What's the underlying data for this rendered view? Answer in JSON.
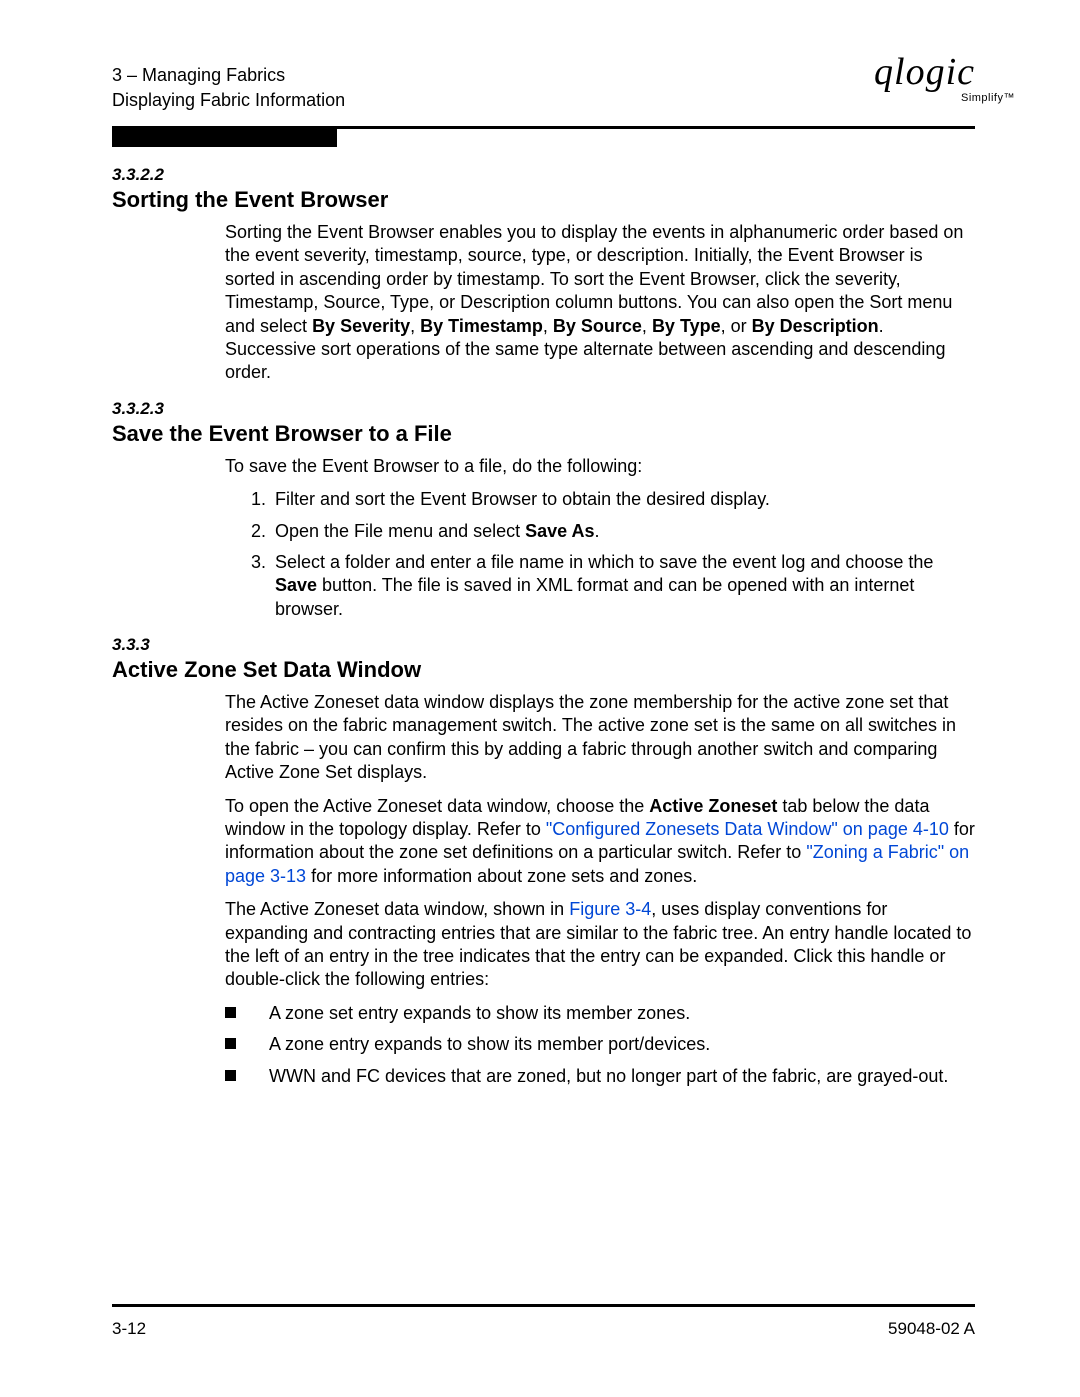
{
  "header": {
    "chapter_line": "3 – Managing Fabrics",
    "subtitle": "Displaying Fabric Information",
    "logo_main": "qlogic",
    "logo_sub": "Simplify™"
  },
  "section1": {
    "num": "3.3.2.2",
    "title": "Sorting the Event Browser",
    "para_a": "Sorting the Event Browser enables you to display the events in alphanumeric order based on the event severity, timestamp, source, type, or description. Initially, the Event Browser is sorted in ascending order by timestamp. To sort the Event Browser, click the severity, Timestamp, Source, Type, or Description column buttons. You can also open the Sort menu and select ",
    "bold1": "By Severity",
    "sep1": ", ",
    "bold2": "By Timestamp",
    "sep2": ", ",
    "bold3": "By Source",
    "sep3": ", ",
    "bold4": "By Type",
    "sep4": ", or ",
    "bold5": "By Description",
    "tail": ". Successive sort operations of the same type alternate between ascending and descending order."
  },
  "section2": {
    "num": "3.3.2.3",
    "title": "Save the Event Browser to a File",
    "intro": "To save the Event Browser to a file, do the following:",
    "step1": "Filter and sort the Event Browser to obtain the desired display.",
    "step2_a": "Open the File menu and select ",
    "step2_b": "Save As",
    "step2_c": ".",
    "step3_a": "Select a folder and enter a file name in which to save the event log and choose the ",
    "step3_b": "Save",
    "step3_c": " button. The file is saved in XML format and can be opened with an internet browser."
  },
  "section3": {
    "num": "3.3.3",
    "title": "Active Zone Set Data Window",
    "p1": "The Active Zoneset data window displays the zone membership for the active zone set that resides on the fabric management switch. The active zone set is the same on all switches in the fabric – you can confirm this by adding a fabric through another switch and comparing Active Zone Set displays.",
    "p2_a": "To open the Active Zoneset data window, choose the ",
    "p2_b": "Active Zoneset",
    "p2_c": " tab below the data window in the topology display. Refer to ",
    "p2_link1": "\"Configured Zonesets Data Window\" on page 4-10",
    "p2_d": " for information about the zone set definitions on a particular switch. Refer to ",
    "p2_link2": "\"Zoning a Fabric\" on page 3-13",
    "p2_e": " for more information about zone sets and zones.",
    "p3_a": "The Active Zoneset data window, shown in ",
    "p3_link": "Figure 3-4",
    "p3_b": ", uses display conventions for expanding and contracting entries that are similar to the fabric tree. An entry handle located to the left of an entry in the tree indicates that the entry can be expanded. Click this handle or double-click the following entries:",
    "b1": "A zone set entry expands to show its member zones.",
    "b2": "A zone entry expands to show its member port/devices.",
    "b3": "WWN and FC devices that are zoned, but no longer part of the fabric, are grayed-out."
  },
  "footer": {
    "page": "3-12",
    "docid": "59048-02 A"
  }
}
